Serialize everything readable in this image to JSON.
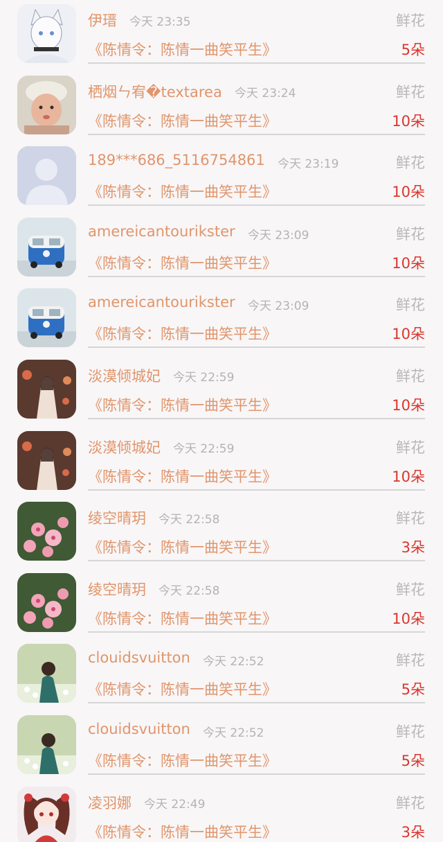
{
  "gift_list": [
    {
      "name": "伊瑨",
      "time": "今天 23:35",
      "gift_type": "鲜花",
      "drama": "《陈情令：陈情一曲笑平生》",
      "count": "5朵",
      "avatar_icon": "anime-catgirl-avatar"
    },
    {
      "name": "栖烟ㄣ宥�textarea",
      "time": "今天 23:24",
      "gift_type": "鲜花",
      "drama": "《陈情令：陈情一曲笑平生》",
      "count": "10朵",
      "avatar_icon": "child-photo-avatar"
    },
    {
      "name": "189***686_5116754861",
      "time": "今天 23:19",
      "gift_type": "鲜花",
      "drama": "《陈情令：陈情一曲笑平生》",
      "count": "10朵",
      "avatar_icon": "default-person-avatar"
    },
    {
      "name": "amereicantourikster",
      "time": "今天 23:09",
      "gift_type": "鲜花",
      "drama": "《陈情令：陈情一曲笑平生》",
      "count": "10朵",
      "avatar_icon": "blue-van-avatar"
    },
    {
      "name": "amereicantourikster",
      "time": "今天 23:09",
      "gift_type": "鲜花",
      "drama": "《陈情令：陈情一曲笑平生》",
      "count": "10朵",
      "avatar_icon": "blue-van-avatar"
    },
    {
      "name": "淡漠倾城妃",
      "time": "今天 22:59",
      "gift_type": "鲜花",
      "drama": "《陈情令：陈情一曲笑平生》",
      "count": "10朵",
      "avatar_icon": "anime-girl-lanterns-avatar"
    },
    {
      "name": "淡漠倾城妃",
      "time": "今天 22:59",
      "gift_type": "鲜花",
      "drama": "《陈情令：陈情一曲笑平生》",
      "count": "10朵",
      "avatar_icon": "anime-girl-lanterns-avatar"
    },
    {
      "name": "绫空晴玥",
      "time": "今天 22:58",
      "gift_type": "鲜花",
      "drama": "《陈情令：陈情一曲笑平生》",
      "count": "3朵",
      "avatar_icon": "pink-blossom-avatar"
    },
    {
      "name": "绫空晴玥",
      "time": "今天 22:58",
      "gift_type": "鲜花",
      "drama": "《陈情令：陈情一曲笑平生》",
      "count": "10朵",
      "avatar_icon": "pink-blossom-avatar"
    },
    {
      "name": "clouidsvuitton",
      "time": "今天 22:52",
      "gift_type": "鲜花",
      "drama": "《陈情令：陈情一曲笑平生》",
      "count": "5朵",
      "avatar_icon": "girl-in-flowers-avatar"
    },
    {
      "name": "clouidsvuitton",
      "time": "今天 22:52",
      "gift_type": "鲜花",
      "drama": "《陈情令：陈情一曲笑平生》",
      "count": "5朵",
      "avatar_icon": "girl-in-flowers-avatar"
    },
    {
      "name": "凌羽娜",
      "time": "今天 22:49",
      "gift_type": "鲜花",
      "drama": "《陈情令：陈情一曲笑平生》",
      "count": "3朵",
      "avatar_icon": "anime-girl-red-avatar"
    }
  ]
}
